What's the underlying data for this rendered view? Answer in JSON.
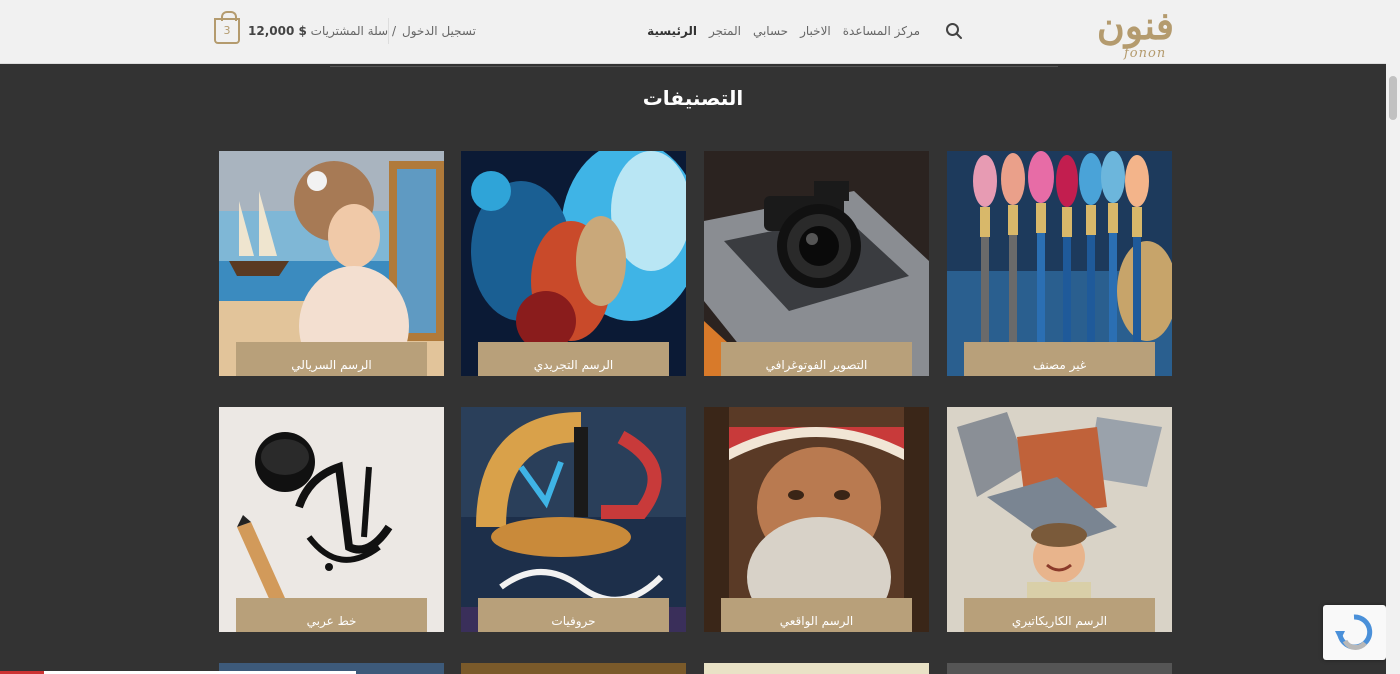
{
  "header": {
    "logo_ar": "فنون",
    "logo_en": "fonon",
    "nav": [
      "الرئيسية",
      "المتجر",
      "حسابي",
      "الاخبار",
      "مركز المساعدة"
    ],
    "login": "تسجيل الدخول",
    "cart_label": "سلة المشتريات /",
    "cart_total": "12,000 $",
    "cart_count": "3",
    "search_icon": "search-icon"
  },
  "main": {
    "title": "التصنيفات",
    "categories": [
      {
        "label": "غير مصنف",
        "icon": "paint-brushes"
      },
      {
        "label": "التصوير الفوتوغرافي",
        "icon": "camera-laptop"
      },
      {
        "label": "الرسم التجريدي",
        "icon": "abstract-art"
      },
      {
        "label": "الرسم السريالي",
        "icon": "surreal-painting"
      },
      {
        "label": "الرسم الكاريكاتيري",
        "icon": "caricature-boy"
      },
      {
        "label": "الرسم الواقعي",
        "icon": "realistic-portrait"
      },
      {
        "label": "حروفيات",
        "icon": "letter-art"
      },
      {
        "label": "خط عربي",
        "icon": "arabic-calligraphy"
      }
    ]
  },
  "colors": {
    "accent": "#b8a07a",
    "background": "#333333",
    "header": "#f1f1f1"
  }
}
